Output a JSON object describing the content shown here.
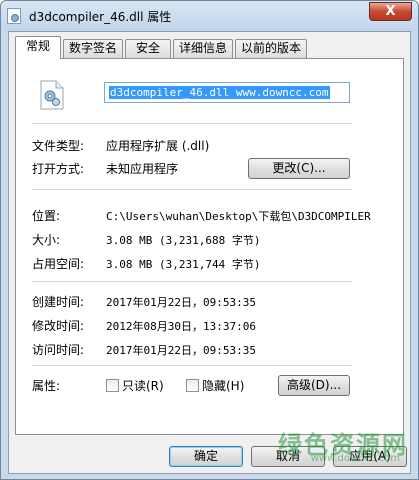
{
  "window": {
    "title": "d3dcompiler_46.dll 属性",
    "close_label": "X"
  },
  "tabs": [
    {
      "label": "常规",
      "active": true
    },
    {
      "label": "数字签名"
    },
    {
      "label": "安全"
    },
    {
      "label": "详细信息"
    },
    {
      "label": "以前的版本"
    }
  ],
  "general": {
    "file_name": "d3dcompiler_46.dll  www.downcc.com",
    "type_label": "文件类型:",
    "type_value": "应用程序扩展 (.dll)",
    "open_label": "打开方式:",
    "open_value": "未知应用程序",
    "change_button": "更改(C)...",
    "location_label": "位置:",
    "location_value": "C:\\Users\\wuhan\\Desktop\\下载包\\D3DCOMPILER",
    "size_label": "大小:",
    "size_value": "3.08 MB (3,231,688 字节)",
    "disk_label": "占用空间:",
    "disk_value": "3.08 MB (3,231,744 字节)",
    "created_label": "创建时间:",
    "created_value": "2017年01月22日，09:53:35",
    "modified_label": "修改时间:",
    "modified_value": "2012年08月30日，13:37:06",
    "accessed_label": "访问时间:",
    "accessed_value": "2017年01月22日，09:53:35",
    "attributes_label": "属性:",
    "readonly_label": "只读(R)",
    "hidden_label": "隐藏(H)",
    "advanced_button": "高级(D)..."
  },
  "footer": {
    "ok_button": "确定",
    "cancel_button": "取消",
    "apply_button": "应用(A)"
  },
  "watermark": {
    "text": "绿色资源网",
    "url": "www.downcc.com"
  },
  "colors": {
    "selection": "#3399ff",
    "title_bar": "#c9d9ea",
    "close_button": "#c74b32"
  }
}
